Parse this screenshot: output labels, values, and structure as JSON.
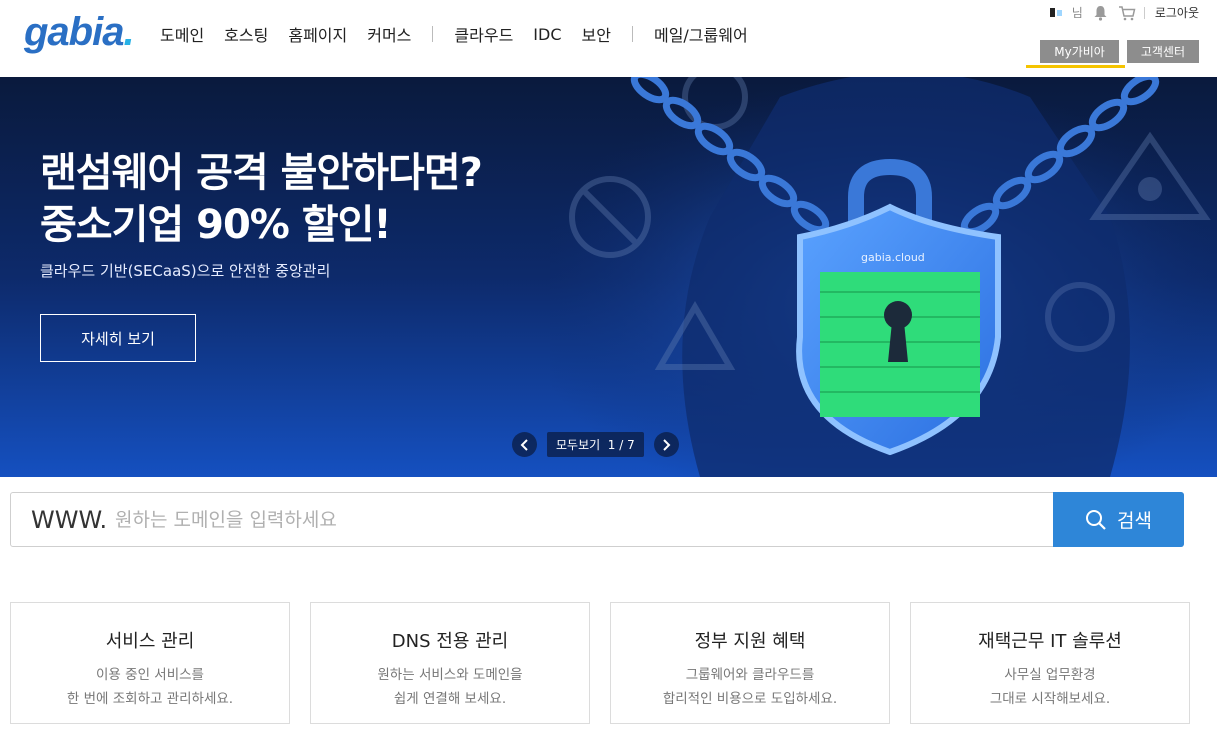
{
  "header": {
    "logo": {
      "text": "gabia",
      "dot": "."
    },
    "nav": [
      "도메인",
      "호스팅",
      "홈페이지",
      "커머스",
      "클라우드",
      "IDC",
      "보안",
      "메일/그룹웨어"
    ],
    "util": {
      "user_suffix": "님",
      "logout": "로그아웃"
    },
    "buttons": {
      "mygabia": "My가비아",
      "support": "고객센터"
    }
  },
  "hero": {
    "title_line1": "랜섬웨어 공격 불안하다면?",
    "title_line2": "중소기업 90% 할인!",
    "subtitle": "클라우드 기반(SECaaS)으로 안전한 중앙관리",
    "cta": "자세히 보기",
    "badge": "gabia.cloud",
    "pager": {
      "label": "모두보기",
      "current": "1",
      "total": "7",
      "display": "모두보기  1 / 7"
    }
  },
  "search": {
    "prefix": "WWW.",
    "placeholder": "원하는 도메인을 입력하세요",
    "value": "",
    "button": "검색"
  },
  "cards": [
    {
      "title": "서비스 관리",
      "line1": "이용 중인 서비스를",
      "line2": "한 번에 조회하고 관리하세요."
    },
    {
      "title": "DNS 전용 관리",
      "line1": "원하는 서비스와 도메인을",
      "line2": "쉽게 연결해 보세요."
    },
    {
      "title": "정부 지원 혜택",
      "line1": "그룹웨어와 클라우드를",
      "line2": "합리적인 비용으로 도입하세요."
    },
    {
      "title": "재택근무 IT 솔루션",
      "line1": "사무실 업무환경",
      "line2": "그대로 시작해보세요."
    }
  ],
  "icons": [
    "bell-icon",
    "cart-icon",
    "search-icon",
    "chevron-left-icon",
    "chevron-right-icon",
    "shield-lock-icon"
  ],
  "colors": {
    "brand": "#2a6fc4",
    "accent": "#2e86d8",
    "active_underline": "#f5c400",
    "shield_green": "#2fdc7a"
  }
}
